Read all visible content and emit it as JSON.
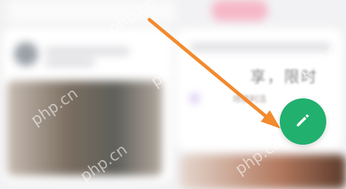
{
  "right_card": {
    "headline": "享，限时",
    "subline": "场福利活"
  },
  "watermark": "php.cn",
  "fab": {
    "icon": "pencil-icon",
    "color": "#21b06e"
  },
  "arrow": {
    "color": "#f28a2e"
  }
}
